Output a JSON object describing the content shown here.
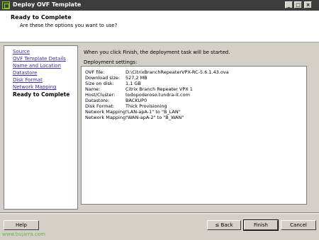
{
  "window": {
    "title": "Deploy OVF Template",
    "icon": "ovf-app-icon",
    "controls": {
      "minimize": "_",
      "maximize": "□",
      "close": "×"
    }
  },
  "header": {
    "title": "Ready to Complete",
    "subtitle": "Are these the options you want to use?"
  },
  "nav": {
    "items": [
      {
        "label": "Source",
        "active": false
      },
      {
        "label": "OVF Template Details",
        "active": false
      },
      {
        "label": "Name and Location",
        "active": false
      },
      {
        "label": "Datastore",
        "active": false
      },
      {
        "label": "Disk Format",
        "active": false
      },
      {
        "label": "Network Mapping",
        "active": false
      },
      {
        "label": "Ready to Complete",
        "active": true
      }
    ]
  },
  "content": {
    "intro": "When you click Finish, the deployment task will be started.",
    "settings_label": "Deployment settings:",
    "settings": [
      {
        "key": "OVF file:",
        "value": "D:\\CitrixBranchRepeaterVPX-RC-5.6.1.43.ova"
      },
      {
        "key": "Download size:",
        "value": "527,2 MB"
      },
      {
        "key": "Size on disk:",
        "value": "1,1 GB"
      },
      {
        "key": "Name:",
        "value": "Citrix Branch Repeater VPX 1"
      },
      {
        "key": "Host/Cluster:",
        "value": "todopoderoso.tundra-it.com"
      },
      {
        "key": "Datastore:",
        "value": "BACKUP0"
      },
      {
        "key": "Disk Format:",
        "value": "Thick Provisioning"
      },
      {
        "key": "Network Mapping:",
        "value": "\"LAN-apA-1\" to \"B_LAN\""
      },
      {
        "key": "Network Mapping:",
        "value": "\"WAN-apA-2\" to \"B_WAN\""
      }
    ]
  },
  "footer": {
    "help": "Help",
    "back": "≤ Back",
    "finish": "Finish",
    "cancel": "Cancel"
  },
  "watermark": "www.bujarra.com",
  "colors": {
    "titlebar": "#3c3c3c",
    "dialog_bg": "#d4d0c8",
    "link": "#3a2fa0",
    "watermark": "#6ab04c"
  }
}
